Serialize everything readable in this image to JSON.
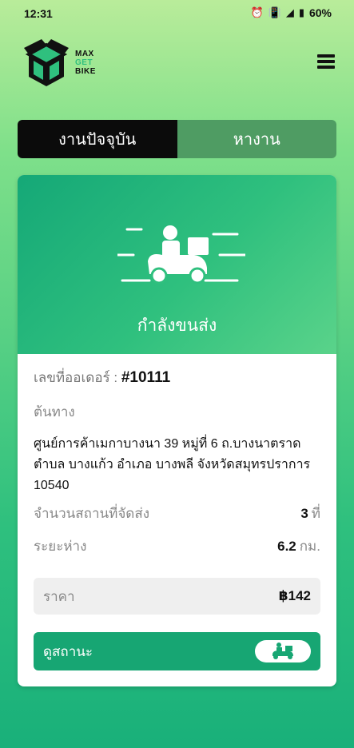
{
  "status_bar": {
    "time": "12:31",
    "battery": "60%"
  },
  "logo": {
    "line1": "MAX",
    "line2": "GET",
    "line3": "BIKE"
  },
  "tabs": [
    {
      "label": "งานปัจจุบัน",
      "active": true
    },
    {
      "label": "หางาน",
      "active": false
    }
  ],
  "card": {
    "status": "กำลังขนส่ง",
    "order_label": "เลขที่ออเดอร์ :",
    "order_number": "#10111",
    "origin_label": "ต้นทาง",
    "address_line1": "ศูนย์การค้าเมกาบางนา 39 หมู่ที่ 6 ถ.บางนาตราด",
    "address_line2": "ตำบล บางแก้ว อำเภอ บางพลี จังหวัดสมุทรปราการ",
    "address_line3": "10540",
    "stops_label": "จำนวนสถานที่จัดส่ง",
    "stops_value": "3",
    "stops_unit": "ที่",
    "distance_label": "ระยะห่าง",
    "distance_value": "6.2",
    "distance_unit": "กม.",
    "price_label": "ราคา",
    "price_value": "฿142",
    "status_button_label": "ดูสถานะ"
  },
  "colors": {
    "accent": "#17a673",
    "dark": "#0b0b0b"
  }
}
